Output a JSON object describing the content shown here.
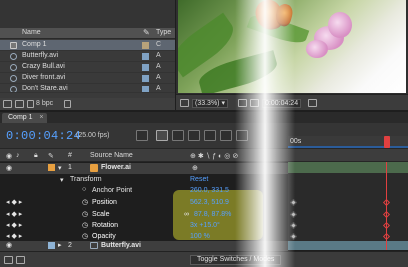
{
  "project": {
    "columns": {
      "name": "Name",
      "type": "Type"
    },
    "items": [
      {
        "name": "Comp 1",
        "type": "C",
        "kind": "comp",
        "label_color": "#b8a27a",
        "selected": true
      },
      {
        "name": "Butterfly.avi",
        "type": "A",
        "kind": "footage",
        "label_color": "#7fa2c4"
      },
      {
        "name": "Crazy Bull.avi",
        "type": "A",
        "kind": "footage",
        "label_color": "#7fa2c4"
      },
      {
        "name": "Diver front.avi",
        "type": "A",
        "kind": "footage",
        "label_color": "#7fa2c4"
      },
      {
        "name": "Don't Stare.avi",
        "type": "A",
        "kind": "footage",
        "label_color": "#7fa2c4"
      }
    ],
    "bpc": "8 bpc"
  },
  "viewer": {
    "zoom": "(33.3%)",
    "timecode": "0:00:04:24"
  },
  "timeline": {
    "tab_label": "Comp 1",
    "timecode": "0:00:04:24",
    "fps": "(25.00 fps)",
    "columns": {
      "num": "#",
      "source": "Source Name"
    },
    "ruler_label": "00s",
    "layers": [
      {
        "num": "1",
        "name": "Flower.ai"
      },
      {
        "num": "2",
        "name": "Butterfly.avi"
      }
    ],
    "transform": {
      "label": "Transform",
      "reset": "Reset"
    },
    "properties": [
      {
        "name": "Anchor Point",
        "value": "260.0, 331.5"
      },
      {
        "name": "Position",
        "value": "562.3, 510.9"
      },
      {
        "name": "Scale",
        "value": "87.8, 87.8%"
      },
      {
        "name": "Rotation",
        "value": "3x +15.0°"
      },
      {
        "name": "Opacity",
        "value": "100 %"
      }
    ],
    "toggle_label": "Toggle Switches / Modes"
  },
  "colors": {
    "accent_blue": "#56a0ff",
    "layer_label_orange": "#e8a040",
    "highlight": "#c9c82e",
    "keyframe_red": "#e04040"
  }
}
